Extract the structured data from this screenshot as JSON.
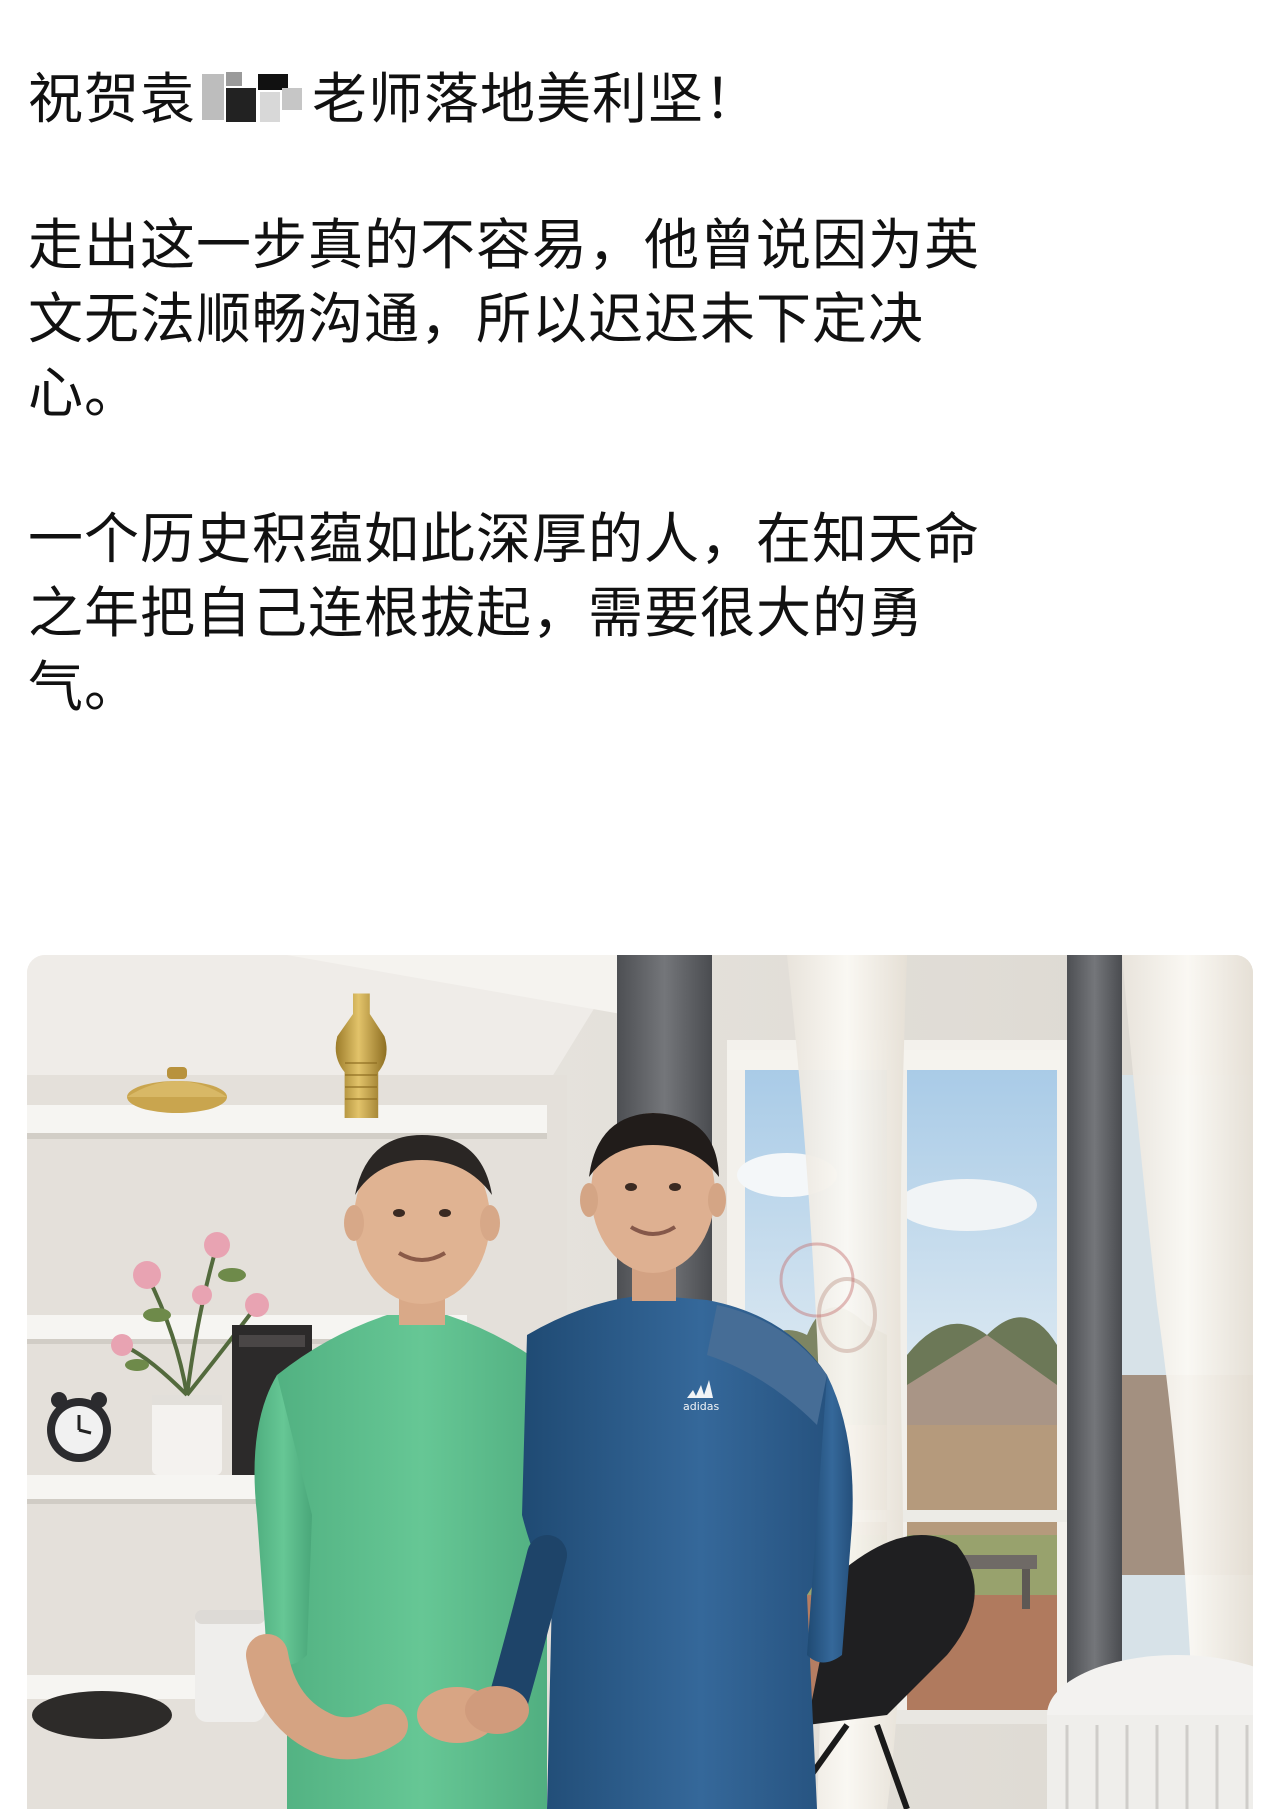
{
  "post": {
    "title_before": "祝贺袁",
    "title_after": "老师落地美利坚！",
    "paragraph_2": [
      "走出这一步真的不容易，他曾说因为英",
      "文无法顺畅沟通，所以迟迟未下定决",
      "心。"
    ],
    "paragraph_3": [
      "一个历史积蕴如此深厚的人，在知天命",
      "之年把自己连根拔起，需要很大的勇",
      "气。"
    ]
  },
  "photo": {
    "shirt_logo": "adidas",
    "colors": {
      "wall": "#e6e3de",
      "shelf": "#f4f3f0",
      "vase": "#c8a449",
      "green_shirt": "#5fc08f",
      "blue_shirt": "#2d5d8c",
      "curtain": "#f1ede6",
      "drape": "#5d5f63",
      "sky": "#b7d5ec",
      "trees": "#6e7b58",
      "fence": "#b79b7e"
    }
  }
}
